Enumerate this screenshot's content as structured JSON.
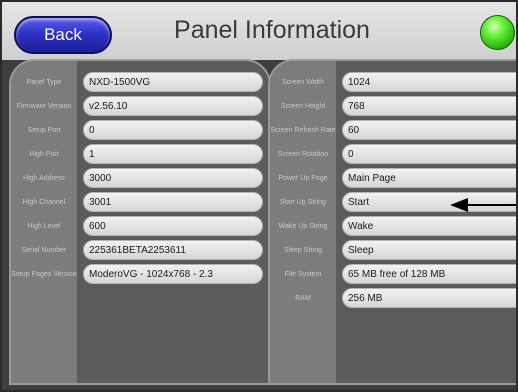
{
  "header": {
    "back_label": "Back",
    "title": "Panel Information"
  },
  "left_fields": [
    {
      "label": "Panel Type",
      "value": "NXD-1500VG"
    },
    {
      "label": "Firmware Version",
      "value": "v2.56.10"
    },
    {
      "label": "Setup Port",
      "value": "0"
    },
    {
      "label": "High Port",
      "value": "1"
    },
    {
      "label": "High Address",
      "value": "3000"
    },
    {
      "label": "High Channel",
      "value": "3001"
    },
    {
      "label": "High Level",
      "value": "600"
    },
    {
      "label": "Serial Number",
      "value": "225361BETA2253611"
    },
    {
      "label": "Setup Pages Version",
      "value": "ModeroVG - 1024x768 - 2.3"
    }
  ],
  "right_fields": [
    {
      "label": "Screen Width",
      "value": "1024"
    },
    {
      "label": "Screen Height",
      "value": "768"
    },
    {
      "label": "Screen Refresh Rate",
      "value": "60"
    },
    {
      "label": "Screen Rotation",
      "value": "0"
    },
    {
      "label": "Power Up Page",
      "value": "Main Page"
    },
    {
      "label": "Start Up String",
      "value": "Start"
    },
    {
      "label": "Wake Up String",
      "value": "Wake"
    },
    {
      "label": "Sleep String",
      "value": "Sleep"
    },
    {
      "label": "File System",
      "value": "65 MB free of 128 MB"
    },
    {
      "label": "RAM",
      "value": "256 MB"
    }
  ],
  "colors": {
    "back_button": "#2f33c4",
    "status_led": "#27b90c",
    "panel_bg": "#5c5c5c",
    "field_bg": "#e4e4e4"
  },
  "icons": {
    "status": "green-led-icon",
    "arrow": "left-arrow-icon"
  }
}
